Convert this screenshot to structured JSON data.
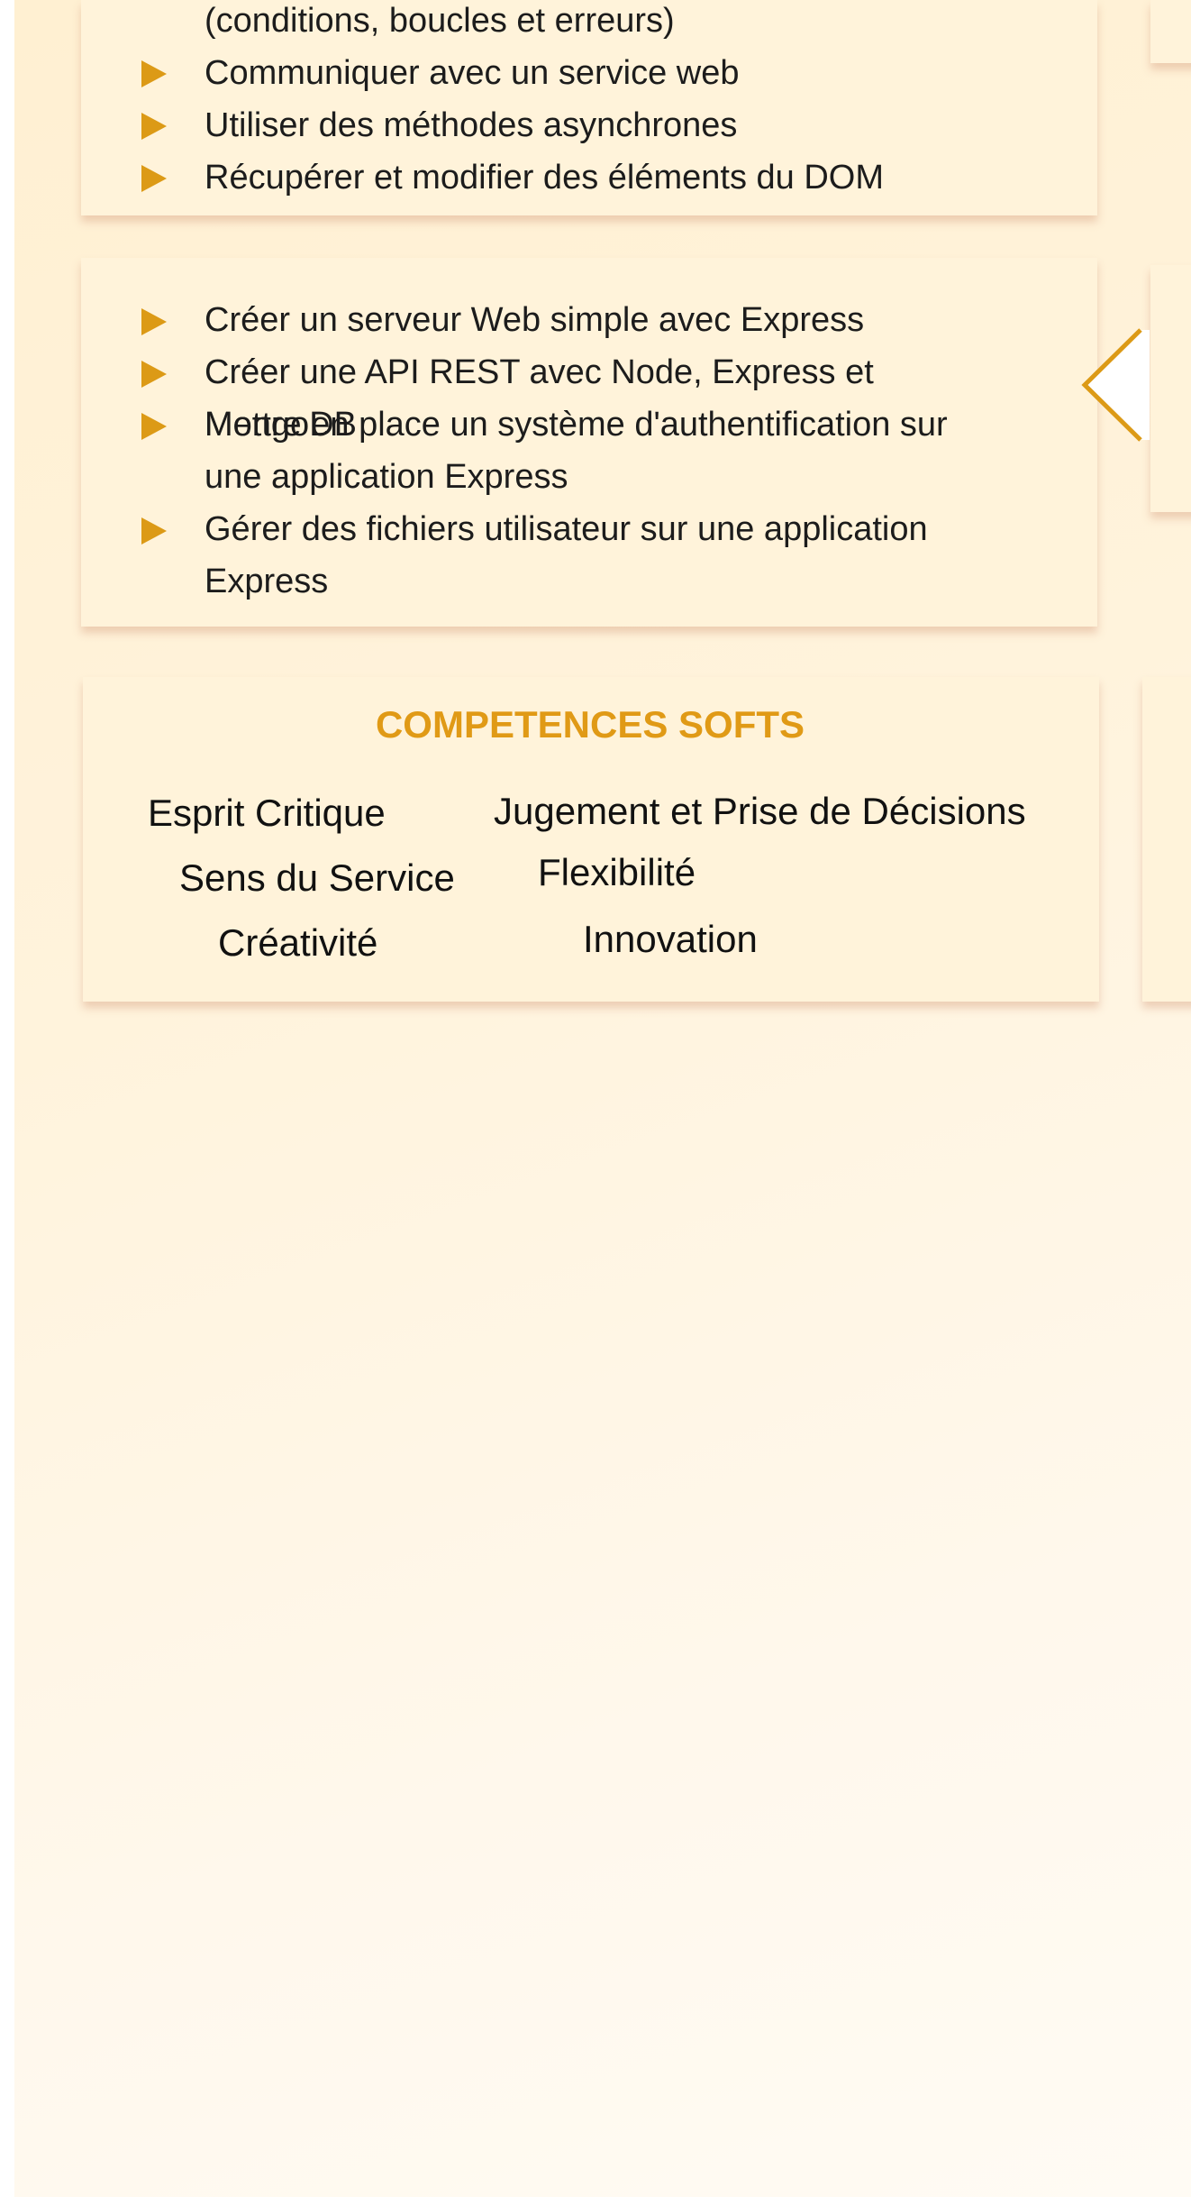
{
  "skills_block_1": {
    "continuation_line": "(conditions, boucles et erreurs)",
    "items": [
      "Communiquer avec un service web",
      "Utiliser des méthodes asynchrones",
      "Récupérer et modifier des éléments du DOM"
    ]
  },
  "skills_block_2": {
    "items": [
      "Créer un serveur Web simple avec Express",
      "Créer une API REST avec Node, Express et MongoDB",
      "Mettre en place un système d'authentification sur une application Express",
      "Gérer des fichiers utilisateur sur une application Express"
    ]
  },
  "soft_skills": {
    "title": "COMPETENCES SOFTS",
    "left_column": [
      "Esprit Critique",
      "Sens du Service",
      "Créativité"
    ],
    "right_column": [
      "Jugement et Prise de Décisions",
      "Flexibilité",
      "Innovation"
    ]
  },
  "colors": {
    "accent": "#dc9a16",
    "card_background": "#fff3da",
    "page_background": "#fff3dc"
  },
  "icons": {
    "bullet": "triangle-right-icon",
    "navigation": "chevron-left-icon"
  }
}
